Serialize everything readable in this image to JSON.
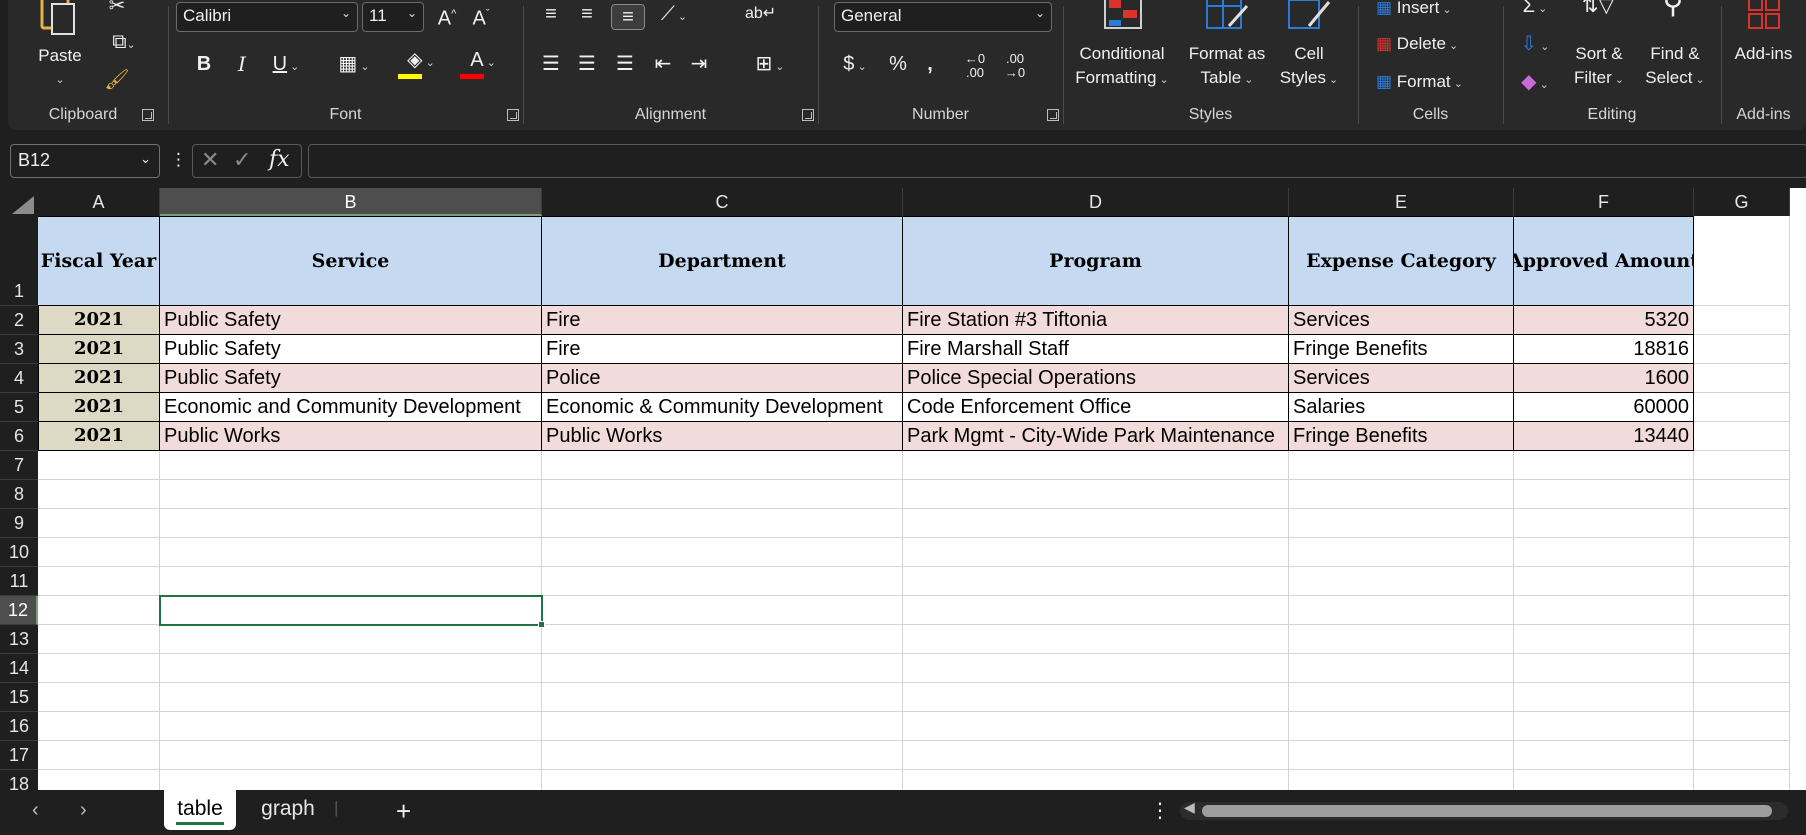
{
  "ribbon": {
    "clipboard": {
      "label": "Clipboard",
      "paste_label": "Paste"
    },
    "font": {
      "label": "Font",
      "font_name": "Calibri",
      "font_size": "11",
      "bold": "B",
      "italic": "I",
      "underline": "U",
      "font_color_glyph": "A",
      "grow_glyph": "A",
      "shrink_glyph": "A",
      "fill_color": "#ffff00",
      "font_color": "#ff0000"
    },
    "alignment": {
      "label": "Alignment"
    },
    "number": {
      "label": "Number",
      "format": "General",
      "currency": "$",
      "percent": "%",
      "comma": "❜",
      "inc_dec": ".00",
      "dec_dec": ".00"
    },
    "styles": {
      "label": "Styles",
      "conditional_1": "Conditional",
      "conditional_2": "Formatting",
      "format_table_1": "Format as",
      "format_table_2": "Table",
      "cell_styles_1": "Cell",
      "cell_styles_2": "Styles"
    },
    "cells": {
      "label": "Cells",
      "insert": "Insert",
      "delete": "Delete",
      "format": "Format"
    },
    "editing": {
      "label": "Editing",
      "sort_1": "Sort &",
      "sort_2": "Filter",
      "find_1": "Find &",
      "find_2": "Select"
    },
    "addins": {
      "label": "Add-ins",
      "button": "Add-ins"
    }
  },
  "formula_bar": {
    "name_box": "B12",
    "formula": ""
  },
  "columns": [
    "A",
    "B",
    "C",
    "D",
    "E",
    "F",
    "G"
  ],
  "rows": [
    "1",
    "2",
    "3",
    "4",
    "5",
    "6",
    "7",
    "8",
    "9",
    "10",
    "11",
    "12",
    "13",
    "14",
    "15",
    "16",
    "17",
    "18"
  ],
  "selected_cell": "B12",
  "table": {
    "headers": [
      "Fiscal Year",
      "Service",
      "Department",
      "Program",
      "Expense Category",
      "Approved Amount"
    ],
    "rows": [
      {
        "year": "2021",
        "service": "Public Safety",
        "department": "Fire",
        "program": "Fire Station #3 Tiftonia",
        "category": "Services",
        "amount": "5320"
      },
      {
        "year": "2021",
        "service": "Public Safety",
        "department": "Fire",
        "program": "Fire Marshall Staff",
        "category": "Fringe Benefits",
        "amount": "18816"
      },
      {
        "year": "2021",
        "service": "Public Safety",
        "department": "Police",
        "program": "Police Special Operations",
        "category": "Services",
        "amount": "1600"
      },
      {
        "year": "2021",
        "service": "Economic and Community Development",
        "department": "Economic & Community Development",
        "program": "Code Enforcement Office",
        "category": "Salaries",
        "amount": "60000"
      },
      {
        "year": "2021",
        "service": "Public Works",
        "department": "Public Works",
        "program": "Park Mgmt - City-Wide Park Maintenance",
        "category": "Fringe Benefits",
        "amount": "13440"
      }
    ]
  },
  "sheets": {
    "tabs": [
      "table",
      "graph"
    ],
    "active": "table",
    "add_glyph": "+"
  },
  "colors": {
    "header_fill": "#c5d9f1",
    "year_fill": "#ddd9c4",
    "row_pink": "#f2dcdb",
    "select_green": "#217346"
  }
}
